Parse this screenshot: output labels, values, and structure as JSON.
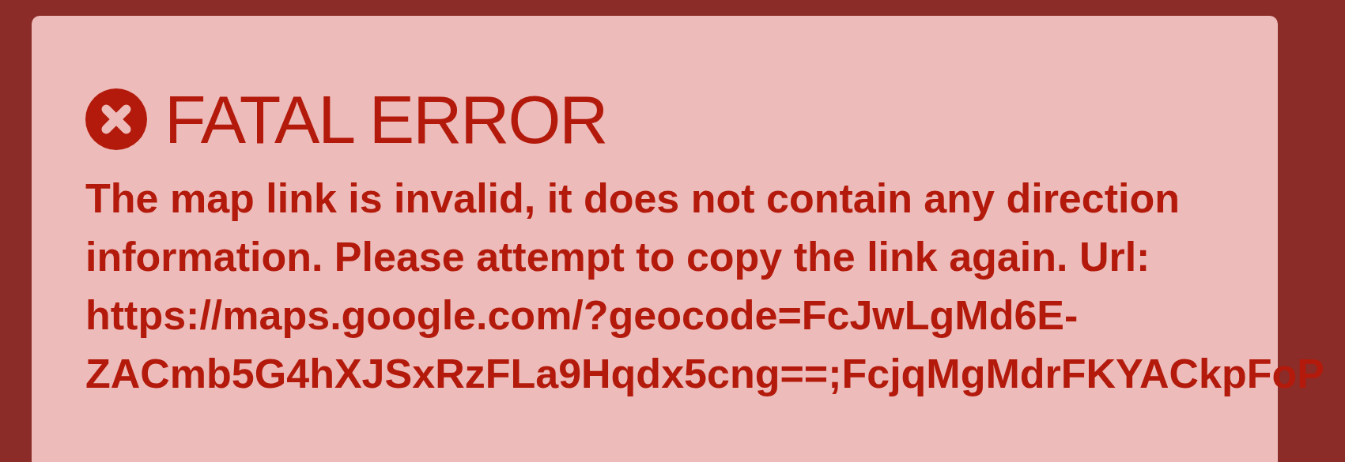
{
  "error": {
    "title": "FATAL ERROR",
    "message": "The map link is invalid, it does not contain any direction information. Please attempt to copy the link again. Url: https://maps.google.com/?geocode=FcJwLgMd6E-ZACmb5G4hXJSxRzFLa9Hqdx5cng==;FcjqMgMdrFKYACkpFoP"
  }
}
